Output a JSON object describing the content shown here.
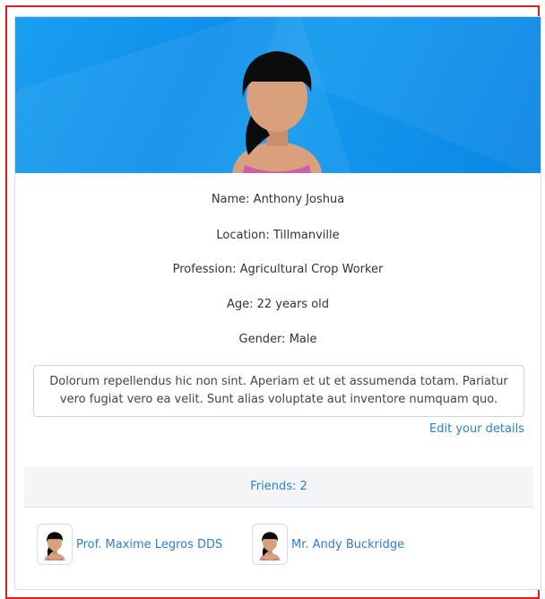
{
  "profile": {
    "name_line": "Name: Anthony Joshua",
    "location_line": "Location: Tillmanville",
    "profession_line": "Profession: Agricultural Crop Worker",
    "age_line": "Age: 22 years old",
    "gender_line": "Gender: Male",
    "bio": "Dolorum repellendus hic non sint. Aperiam et ut et assumenda totam. Pariatur vero fugiat vero ea velit. Sunt alias voluptate aut inventore numquam quo.",
    "edit_label": "Edit your details",
    "avatar_icon": "female-avatar-icon"
  },
  "friends": {
    "header": "Friends: 2",
    "items": [
      {
        "name": "Prof. Maxime Legros DDS",
        "avatar_icon": "female-avatar-icon"
      },
      {
        "name": "Mr. Andy Buckridge",
        "avatar_icon": "female-avatar-icon"
      }
    ]
  },
  "colors": {
    "banner": "#1399ee",
    "link": "#2a7fd4",
    "frame": "#e21b1b"
  }
}
